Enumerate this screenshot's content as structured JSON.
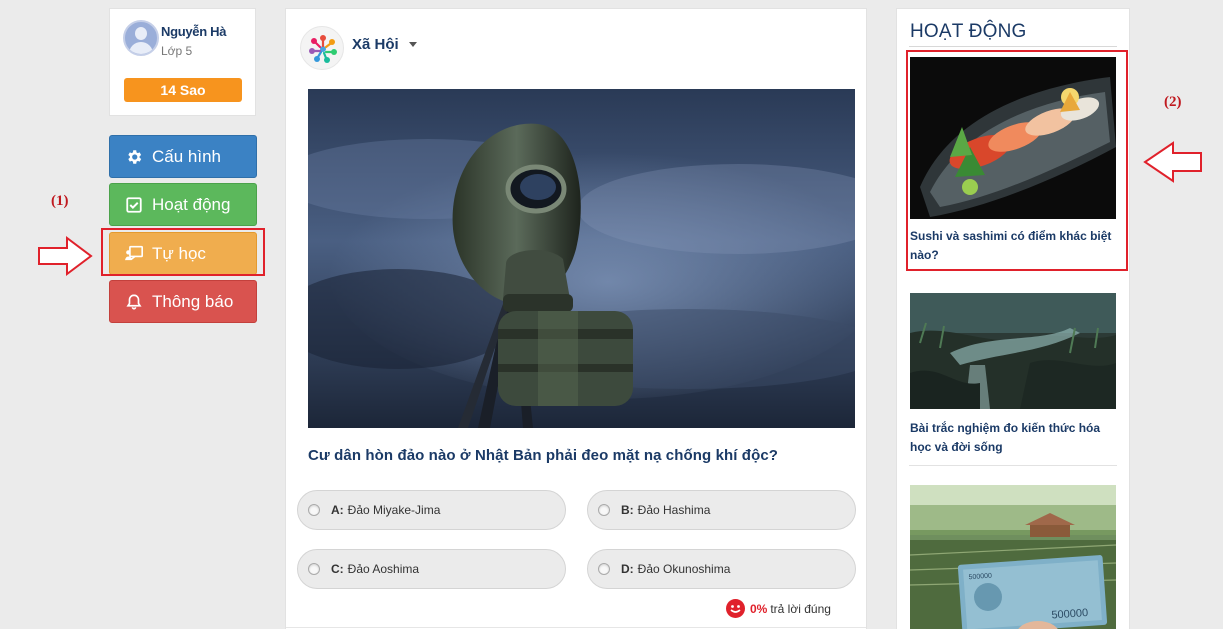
{
  "profile": {
    "name": "Nguyễn Hà",
    "class_label": "Lớp 5",
    "stars": "14 Sao"
  },
  "menu": [
    {
      "label": "Cấu hình",
      "icon": "gear-icon",
      "color": "#3b82c4"
    },
    {
      "label": "Hoạt động",
      "icon": "checkbox-icon",
      "color": "#5cb85c"
    },
    {
      "label": "Tự học",
      "icon": "teacher-board-icon",
      "color": "#f0ad4e"
    },
    {
      "label": "Thông báo",
      "icon": "bell-icon",
      "color": "#d9534f"
    }
  ],
  "annotations": {
    "one": "(1)",
    "two": "(2)"
  },
  "post": {
    "category": "Xã Hội",
    "question": "Cư dân hòn đảo nào ở Nhật Bản phải đeo mặt nạ chống khí độc?",
    "answers": [
      {
        "letter": "A:",
        "text": "Đảo Miyake-Jima"
      },
      {
        "letter": "B:",
        "text": "Đảo Hashima"
      },
      {
        "letter": "C:",
        "text": "Đảo Aoshima"
      },
      {
        "letter": "D:",
        "text": "Đảo Okunoshima"
      }
    ],
    "stat_percent": "0%",
    "stat_label": "trả lời đúng"
  },
  "sidebar": {
    "title": "HOẠT ĐỘNG",
    "items": [
      {
        "title": "Sushi và sashimi có điểm khác biệt nào?"
      },
      {
        "title": "Bài trắc nghiệm đo kiến thức hóa học và đời sống"
      },
      {
        "title": ""
      }
    ]
  },
  "colors": {
    "accent_red": "#e0212b",
    "navy": "#1b3a66",
    "orange": "#f7941e"
  }
}
